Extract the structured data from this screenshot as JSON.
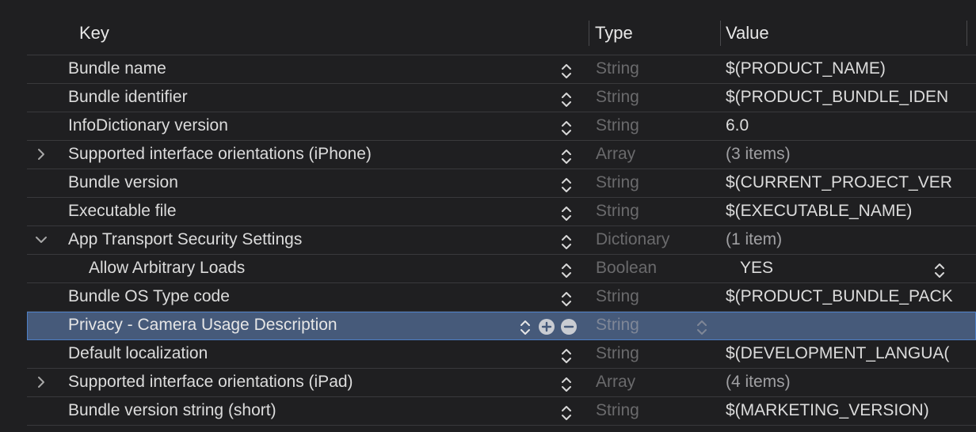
{
  "columns": {
    "key": "Key",
    "type": "Type",
    "value": "Value"
  },
  "rows": [
    {
      "key": "Bundle name",
      "type": "String",
      "value": "$(PRODUCT_NAME)"
    },
    {
      "key": "Bundle identifier",
      "type": "String",
      "value": "$(PRODUCT_BUNDLE_IDEN"
    },
    {
      "key": "InfoDictionary version",
      "type": "String",
      "value": "6.0"
    },
    {
      "key": "Supported interface orientations (iPhone)",
      "type": "Array",
      "value": "(3 items)",
      "disclosure": "collapsed"
    },
    {
      "key": "Bundle version",
      "type": "String",
      "value": "$(CURRENT_PROJECT_VER"
    },
    {
      "key": "Executable file",
      "type": "String",
      "value": "$(EXECUTABLE_NAME)"
    },
    {
      "key": "App Transport Security Settings",
      "type": "Dictionary",
      "value": "(1 item)",
      "disclosure": "expanded"
    },
    {
      "key": "Allow Arbitrary Loads",
      "type": "Boolean",
      "value": "YES"
    },
    {
      "key": "Bundle OS Type code",
      "type": "String",
      "value": "$(PRODUCT_BUNDLE_PACK"
    },
    {
      "key": "Privacy - Camera Usage Description",
      "type": "String",
      "value": "",
      "selected": true
    },
    {
      "key": "Default localization",
      "type": "String",
      "value": "$(DEVELOPMENT_LANGUA("
    },
    {
      "key": "Supported interface orientations (iPad)",
      "type": "Array",
      "value": "(4 items)",
      "disclosure": "collapsed"
    },
    {
      "key": "Bundle version string (short)",
      "type": "String",
      "value": "$(MARKETING_VERSION)"
    }
  ],
  "colors": {
    "background": "#1f1f21",
    "selection": "#465a7a",
    "selection_border": "#4d7fc5"
  }
}
